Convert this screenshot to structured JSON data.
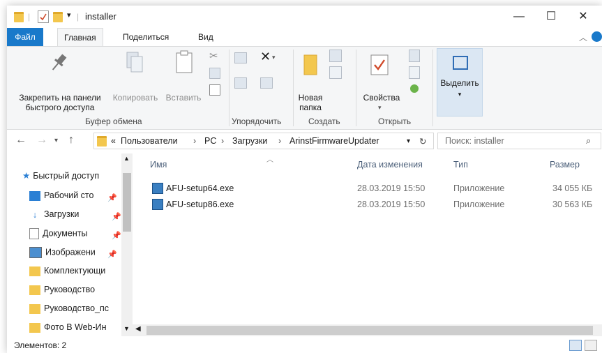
{
  "window": {
    "title": "installer",
    "minimize_glyph": "—",
    "maximize_glyph": "☐",
    "close_glyph": "✕"
  },
  "ribbon_tabs": {
    "file": "Файл",
    "home": "Главная",
    "share": "Поделиться",
    "view": "Вид"
  },
  "ribbon": {
    "pin_line1": "Закрепить на панели",
    "pin_line2": "быстрого доступа",
    "copy": "Копировать",
    "paste": "Вставить",
    "new_folder_line1": "Новая",
    "new_folder_line2": "папка",
    "properties": "Свойства",
    "select": "Выделить",
    "groups": {
      "clipboard": "Буфер обмена",
      "organize": "Упорядочить",
      "create": "Создать",
      "open": "Открыть"
    }
  },
  "address": {
    "overflow": "«",
    "crumbs": [
      "Пользователи",
      "PC",
      "Загрузки",
      "ArinstFirmwareUpdater"
    ],
    "separator": "›"
  },
  "search": {
    "placeholder": "Поиск: installer"
  },
  "nav": {
    "quick_access": "Быстрый доступ",
    "items": [
      {
        "label": "Рабочий сто",
        "icon": "desktop-icon"
      },
      {
        "label": "Загрузки",
        "icon": "download-icon"
      },
      {
        "label": "Документы",
        "icon": "documents-icon"
      },
      {
        "label": "Изображени",
        "icon": "pictures-icon"
      },
      {
        "label": "Комплектующи",
        "icon": "folder-icon"
      },
      {
        "label": "Руководство",
        "icon": "folder-icon"
      },
      {
        "label": "Руководство_пс",
        "icon": "folder-icon"
      },
      {
        "label": "Фото В Web-Ин",
        "icon": "folder-icon"
      }
    ]
  },
  "columns": {
    "name": "Имя",
    "date": "Дата изменения",
    "type": "Тип",
    "size": "Размер"
  },
  "files": [
    {
      "name": "AFU-setup64.exe",
      "date": "28.03.2019 15:50",
      "type": "Приложение",
      "size": "34 055 КБ"
    },
    {
      "name": "AFU-setup86.exe",
      "date": "28.03.2019 15:50",
      "type": "Приложение",
      "size": "30 563 КБ"
    }
  ],
  "status": {
    "items_count": "Элементов: 2"
  },
  "colors": {
    "accent": "#1979ca",
    "folder": "#f3c74e"
  }
}
